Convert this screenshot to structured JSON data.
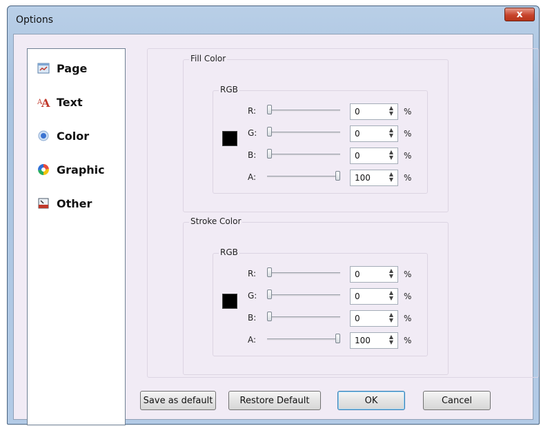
{
  "window": {
    "title": "Options",
    "close_glyph": "x"
  },
  "nav": {
    "items": [
      {
        "label": "Page",
        "icon": "page-icon"
      },
      {
        "label": "Text",
        "icon": "text-icon"
      },
      {
        "label": "Color",
        "icon": "color-icon"
      },
      {
        "label": "Graphic",
        "icon": "graphic-icon"
      },
      {
        "label": "Other",
        "icon": "other-icon"
      }
    ]
  },
  "fill": {
    "label": "Fill Color",
    "sub": "RGB",
    "swatch_color": "#000000",
    "channels": [
      {
        "name": "R:",
        "value": "0",
        "unit": "%",
        "level": 0
      },
      {
        "name": "G:",
        "value": "0",
        "unit": "%",
        "level": 0
      },
      {
        "name": "B:",
        "value": "0",
        "unit": "%",
        "level": 0
      },
      {
        "name": "A:",
        "value": "100",
        "unit": "%",
        "level": 100
      }
    ]
  },
  "stroke": {
    "label": "Stroke Color",
    "sub": "RGB",
    "swatch_color": "#000000",
    "channels": [
      {
        "name": "R:",
        "value": "0",
        "unit": "%",
        "level": 0
      },
      {
        "name": "G:",
        "value": "0",
        "unit": "%",
        "level": 0
      },
      {
        "name": "B:",
        "value": "0",
        "unit": "%",
        "level": 0
      },
      {
        "name": "A:",
        "value": "100",
        "unit": "%",
        "level": 100
      }
    ]
  },
  "buttons": {
    "save_default": "Save as default",
    "restore_default": "Restore Default",
    "ok": "OK",
    "cancel": "Cancel"
  }
}
